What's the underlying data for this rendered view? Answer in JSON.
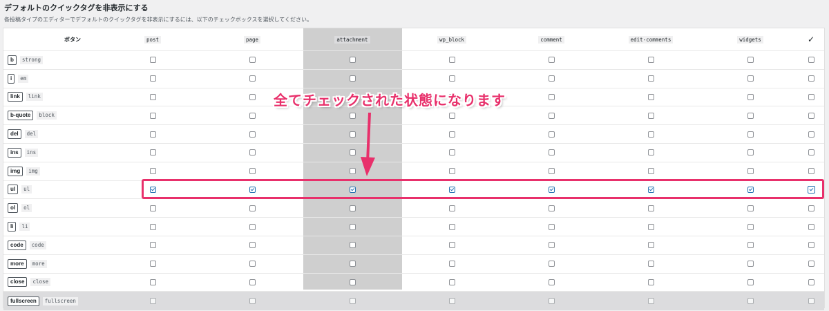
{
  "title": "デフォルトのクイックタグを非表示にする",
  "description": "各投稿タイプのエディターでデフォルトのクイックタグを非表示にするには、以下のチェックボックスを選択してください。",
  "columns": {
    "button": "ボタン",
    "post_types": [
      "post",
      "page",
      "attachment",
      "wp_block",
      "comment",
      "edit-comments",
      "widgets"
    ],
    "all": "✓"
  },
  "rows": [
    {
      "label": "b",
      "code": "strong",
      "checked": false
    },
    {
      "label": "i",
      "code": "em",
      "checked": false
    },
    {
      "label": "link",
      "code": "link",
      "checked": false
    },
    {
      "label": "b-quote",
      "code": "block",
      "checked": false
    },
    {
      "label": "del",
      "code": "del",
      "checked": false
    },
    {
      "label": "ins",
      "code": "ins",
      "checked": false
    },
    {
      "label": "img",
      "code": "img",
      "checked": false
    },
    {
      "label": "ul",
      "code": "ul",
      "checked": true
    },
    {
      "label": "ol",
      "code": "ol",
      "checked": false
    },
    {
      "label": "li",
      "code": "li",
      "checked": false
    },
    {
      "label": "code",
      "code": "code",
      "checked": false
    },
    {
      "label": "more",
      "code": "more",
      "checked": false
    },
    {
      "label": "close",
      "code": "close",
      "checked": false
    },
    {
      "label": "fullscreen",
      "code": "fullscreen",
      "checked": false
    }
  ],
  "annotation": {
    "text": "全てチェックされた状態になります",
    "color": "#e8306b"
  },
  "colors": {
    "accent": "#2271b1",
    "highlight_column": "#cfcfcf"
  }
}
